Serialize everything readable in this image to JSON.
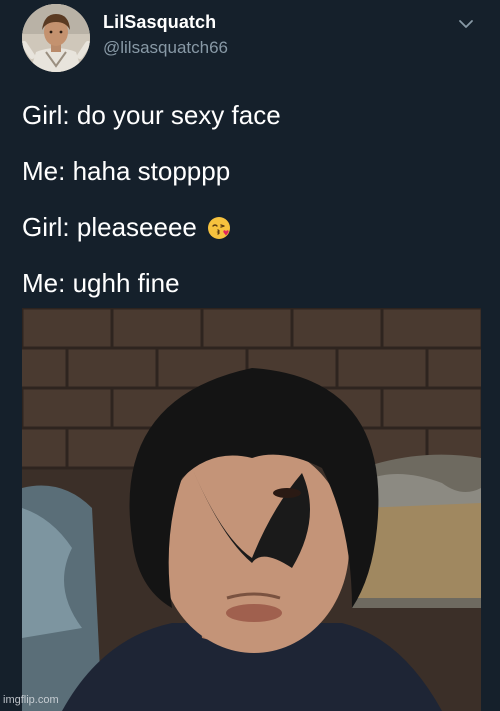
{
  "user": {
    "display_name": "LilSasquatch",
    "handle": "@lilsasquatch66",
    "avatar_icon": "profile-photo"
  },
  "menu": {
    "icon": "chevron-down-icon"
  },
  "tweet": {
    "lines": [
      {
        "text": "Girl: do your sexy face"
      },
      {
        "text": "Me: haha stopppp"
      },
      {
        "text": "Girl: pleaseeee",
        "emoji": "face-blowing-a-kiss"
      },
      {
        "text": "Me: ughh fine"
      }
    ]
  },
  "media": {
    "description_icon": "selfie-photo"
  },
  "watermark": {
    "text": "imgflip.com"
  },
  "colors": {
    "background": "#15202b",
    "text": "#ffffff",
    "secondary_text": "#8899a6"
  }
}
